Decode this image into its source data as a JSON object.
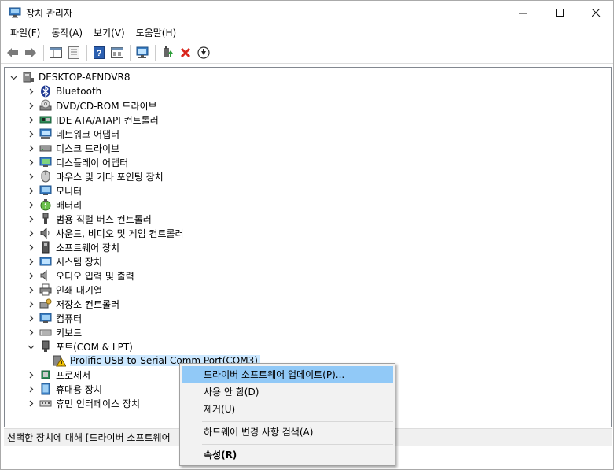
{
  "window": {
    "title": "장치 관리자"
  },
  "menu": [
    "파일(F)",
    "동작(A)",
    "보기(V)",
    "도움말(H)"
  ],
  "toolbar_icons": [
    "back-arrow-icon",
    "forward-arrow-icon",
    "show-hide-tree-icon",
    "properties-icon",
    "help-icon",
    "view-icon",
    "monitor-scan-icon",
    "update-driver-icon",
    "uninstall-x-icon",
    "disable-down-arrow-icon"
  ],
  "tree": {
    "root": "DESKTOP-AFNDVR8",
    "items": [
      {
        "label": "Bluetooth",
        "icon": "bluetooth-icon"
      },
      {
        "label": "DVD/CD-ROM 드라이브",
        "icon": "dvd-drive-icon"
      },
      {
        "label": "IDE ATA/ATAPI 컨트롤러",
        "icon": "ide-controller-icon"
      },
      {
        "label": "네트워크 어댑터",
        "icon": "network-adapter-icon"
      },
      {
        "label": "디스크 드라이브",
        "icon": "disk-drive-icon"
      },
      {
        "label": "디스플레이 어댑터",
        "icon": "display-adapter-icon"
      },
      {
        "label": "마우스 및 기타 포인팅 장치",
        "icon": "mouse-icon"
      },
      {
        "label": "모니터",
        "icon": "monitor-icon"
      },
      {
        "label": "배터리",
        "icon": "battery-icon"
      },
      {
        "label": "범용 직렬 버스 컨트롤러",
        "icon": "usb-controller-icon"
      },
      {
        "label": "사운드, 비디오 및 게임 컨트롤러",
        "icon": "sound-icon"
      },
      {
        "label": "소프트웨어 장치",
        "icon": "software-device-icon"
      },
      {
        "label": "시스템 장치",
        "icon": "system-device-icon"
      },
      {
        "label": "오디오 입력 및 출력",
        "icon": "audio-io-icon"
      },
      {
        "label": "인쇄 대기열",
        "icon": "printer-icon"
      },
      {
        "label": "저장소 컨트롤러",
        "icon": "storage-controller-icon"
      },
      {
        "label": "컴퓨터",
        "icon": "computer-icon"
      },
      {
        "label": "키보드",
        "icon": "keyboard-icon"
      },
      {
        "label": "포트(COM & LPT)",
        "icon": "port-icon",
        "expanded": true
      },
      {
        "label": "Prolific USB-to-Serial Comm Port(COM3)",
        "icon": "warning-icon",
        "child": true,
        "selected": true
      },
      {
        "label": "프로세서",
        "icon": "processor-icon"
      },
      {
        "label": "휴대용 장치",
        "icon": "portable-device-icon"
      },
      {
        "label": "휴먼 인터페이스 장치",
        "icon": "hid-icon"
      }
    ]
  },
  "status": "선택한 장치에 대해 [드라이버 소프트웨어",
  "context_menu": {
    "update_driver": "드라이버 소프트웨어 업데이트(P)...",
    "disable": "사용 안 함(D)",
    "uninstall": "제거(U)",
    "scan": "하드웨어 변경 사항 검색(A)",
    "properties": "속성(R)"
  },
  "colors": {
    "selection": "#cce8ff",
    "menu_highlight": "#91c9f7",
    "uninstall_red": "#d9261c",
    "warning_yellow": "#f5c400"
  }
}
